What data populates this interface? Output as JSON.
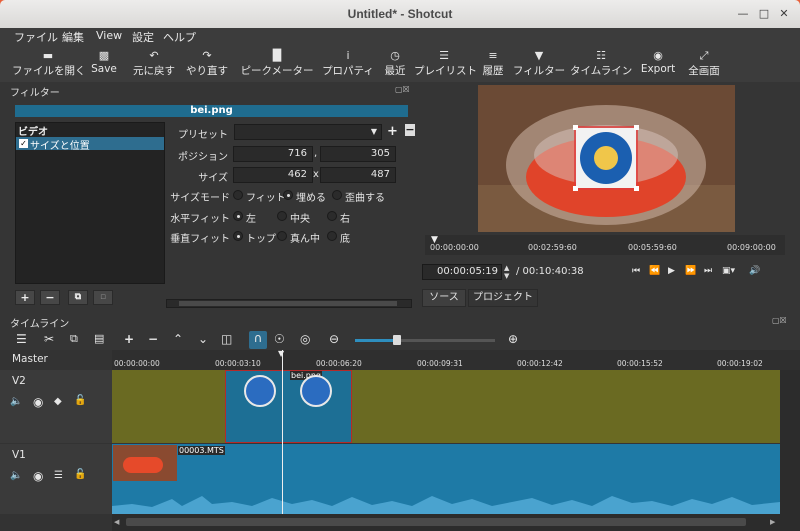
{
  "window": {
    "title": "Untitled* - Shotcut"
  },
  "menu": [
    "ファイル",
    "編集",
    "View",
    "設定",
    "ヘルプ"
  ],
  "toolbar": [
    {
      "icon": "folder-open-icon",
      "label": "ファイルを開く"
    },
    {
      "icon": "save-icon",
      "label": "Save"
    },
    {
      "icon": "undo-icon",
      "label": "元に戻す"
    },
    {
      "icon": "redo-icon",
      "label": "やり直す"
    },
    {
      "icon": "peak-meter-icon",
      "label": "ピークメーター"
    },
    {
      "icon": "properties-icon",
      "label": "プロパティ"
    },
    {
      "icon": "recent-icon",
      "label": "最近"
    },
    {
      "icon": "playlist-icon",
      "label": "プレイリスト"
    },
    {
      "icon": "history-icon",
      "label": "履歴"
    },
    {
      "icon": "filter-icon",
      "label": "フィルター"
    },
    {
      "icon": "timeline-icon",
      "label": "タイムライン"
    },
    {
      "icon": "export-icon",
      "label": "Export"
    },
    {
      "icon": "fullscreen-icon",
      "label": "全画面"
    }
  ],
  "filters": {
    "title": "フィルター",
    "file": "bei.png",
    "category": "ビデオ",
    "selected_filter": "サイズと位置",
    "preset_label": "プリセット",
    "position_label": "ポジション",
    "position_x": "716",
    "position_sep": ",",
    "position_y": "305",
    "size_label": "サイズ",
    "size_w": "462",
    "size_sep": "x",
    "size_h": "487",
    "size_mode_label": "サイズモード",
    "size_mode_options": [
      "フィット",
      "埋める",
      "歪曲する"
    ],
    "size_mode_selected": 1,
    "hfit_label": "水平フィット",
    "hfit_options": [
      "左",
      "中央",
      "右"
    ],
    "hfit_selected": 0,
    "vfit_label": "垂直フィット",
    "vfit_options": [
      "トップ",
      "真ん中",
      "底"
    ],
    "vfit_selected": 0
  },
  "player": {
    "ruler_ticks": [
      "00:00:00:00",
      "00:02:59:60",
      "00:05:59:60",
      "00:09:00:00"
    ],
    "current_time": "00:00:05:19",
    "total_time": "/ 00:10:40:38",
    "tabs": [
      "ソース",
      "プロジェクト"
    ]
  },
  "timeline": {
    "title": "タイムライン",
    "master_label": "Master",
    "ruler_ticks": [
      "00:00:00:00",
      "00:00:03:10",
      "00:00:06:20",
      "00:00:09:31",
      "00:00:12:42",
      "00:00:15:52",
      "00:00:19:02"
    ],
    "tracks": [
      {
        "name": "V2",
        "clip": "bei.png"
      },
      {
        "name": "V1",
        "clip": "00003.MTS"
      }
    ],
    "zoom_level": 0.25
  }
}
